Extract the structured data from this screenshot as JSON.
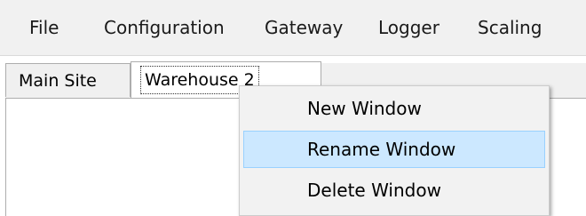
{
  "menubar": {
    "items": [
      "File",
      "Configuration",
      "Gateway",
      "Logger",
      "Scaling"
    ]
  },
  "tabs": {
    "items": [
      {
        "label": "Main Site",
        "selected": false
      },
      {
        "label": "Warehouse 2",
        "selected": true
      }
    ]
  },
  "context_menu": {
    "items": [
      {
        "label": "New Window",
        "highlighted": false
      },
      {
        "label": "Rename Window",
        "highlighted": true
      },
      {
        "label": "Delete Window",
        "highlighted": false
      }
    ]
  },
  "colors": {
    "menubar_bg": "#f1f1f1",
    "highlight_bg": "#cce8ff",
    "highlight_border": "#99d1ff"
  }
}
